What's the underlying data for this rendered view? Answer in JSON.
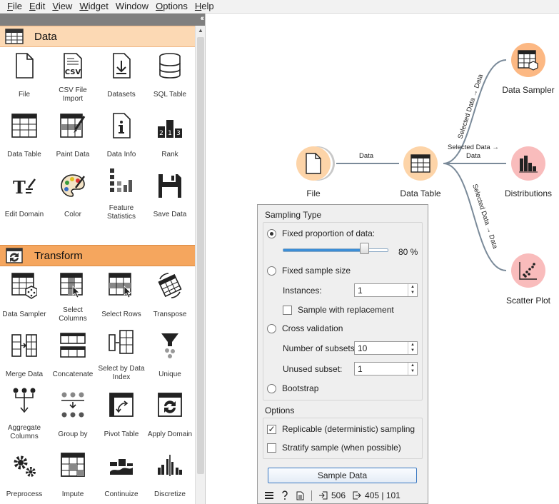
{
  "menu": {
    "items": [
      {
        "label": "File",
        "mnemonic": "F",
        "rest": "ile"
      },
      {
        "label": "Edit",
        "mnemonic": "E",
        "rest": "dit"
      },
      {
        "label": "View",
        "mnemonic": "V",
        "rest": "iew"
      },
      {
        "label": "Widget",
        "mnemonic": "W",
        "rest": "idget"
      },
      {
        "label": "Window",
        "mnemonic": "",
        "rest": "Window"
      },
      {
        "label": "Options",
        "mnemonic": "O",
        "rest": "ptions"
      },
      {
        "label": "Help",
        "mnemonic": "H",
        "rest": "elp"
      }
    ]
  },
  "toolbox": {
    "data_category": {
      "title": "Data",
      "widgets": [
        {
          "label": "File",
          "icon": "file-icon"
        },
        {
          "label": "CSV File Import",
          "icon": "csv-file-icon"
        },
        {
          "label": "Datasets",
          "icon": "datasets-icon"
        },
        {
          "label": "SQL Table",
          "icon": "database-icon"
        },
        {
          "label": "Data Table",
          "icon": "table-icon"
        },
        {
          "label": "Paint Data",
          "icon": "paint-data-icon"
        },
        {
          "label": "Data Info",
          "icon": "info-icon"
        },
        {
          "label": "Rank",
          "icon": "rank-icon"
        },
        {
          "label": "Edit Domain",
          "icon": "edit-domain-icon"
        },
        {
          "label": "Color",
          "icon": "palette-icon"
        },
        {
          "label": "Feature Statistics",
          "icon": "feature-statistics-icon"
        },
        {
          "label": "Save Data",
          "icon": "floppy-disk-icon"
        }
      ]
    },
    "transform_category": {
      "title": "Transform",
      "widgets": [
        {
          "label": "Data Sampler",
          "icon": "data-sampler-icon"
        },
        {
          "label": "Select Columns",
          "icon": "select-columns-icon"
        },
        {
          "label": "Select Rows",
          "icon": "select-rows-icon"
        },
        {
          "label": "Transpose",
          "icon": "transpose-icon"
        },
        {
          "label": "Merge Data",
          "icon": "merge-data-icon"
        },
        {
          "label": "Concatenate",
          "icon": "concatenate-icon"
        },
        {
          "label": "Select by Data Index",
          "icon": "select-by-index-icon"
        },
        {
          "label": "Unique",
          "icon": "funnel-icon"
        },
        {
          "label": "Aggregate Columns",
          "icon": "aggregate-icon"
        },
        {
          "label": "Group by",
          "icon": "group-by-icon"
        },
        {
          "label": "Pivot Table",
          "icon": "pivot-icon"
        },
        {
          "label": "Apply Domain",
          "icon": "apply-domain-icon"
        },
        {
          "label": "Preprocess",
          "icon": "gears-icon"
        },
        {
          "label": "Impute",
          "icon": "impute-icon"
        },
        {
          "label": "Continuize",
          "icon": "continuize-icon"
        },
        {
          "label": "Discretize",
          "icon": "discretize-icon"
        }
      ]
    }
  },
  "canvas": {
    "nodes": [
      {
        "id": "file",
        "label": "File",
        "icon": "file-icon"
      },
      {
        "id": "data-table",
        "label": "Data Table",
        "icon": "table-icon"
      },
      {
        "id": "data-sampler",
        "label": "Data Sampler",
        "icon": "data-sampler-icon"
      },
      {
        "id": "distributions",
        "label": "Distributions",
        "icon": "bar-chart-icon"
      },
      {
        "id": "scatter-plot",
        "label": "Scatter Plot",
        "icon": "scatter-icon"
      }
    ],
    "links": [
      {
        "from": "file",
        "to": "data-table",
        "label": "Data"
      },
      {
        "from": "data-table",
        "to": "data-sampler",
        "label": "Selected Data → Data"
      },
      {
        "from": "data-table",
        "to": "distributions",
        "label_line1": "Selected Data →",
        "label_line2": "Data"
      },
      {
        "from": "data-table",
        "to": "scatter-plot",
        "label": "Selected Data → Data"
      }
    ]
  },
  "sampler": {
    "sampling_type_title": "Sampling Type",
    "fixed_proportion_label": "Fixed proportion of data:",
    "proportion_percent": 80,
    "proportion_display": "80 %",
    "fixed_sample_size_label": "Fixed sample size",
    "instances_label": "Instances:",
    "instances_value": "1",
    "sample_with_replacement_label": "Sample with replacement",
    "cross_validation_label": "Cross validation",
    "number_of_subsets_label": "Number of subsets:",
    "number_of_subsets_value": "10",
    "unused_subset_label": "Unused subset:",
    "unused_subset_value": "1",
    "bootstrap_label": "Bootstrap",
    "options_title": "Options",
    "replicable_label": "Replicable (deterministic) sampling",
    "replicable_checked": true,
    "stratify_label": "Stratify sample (when possible)",
    "stratify_checked": false,
    "sample_button_label": "Sample Data",
    "status": {
      "input_count": "506",
      "output_count": "405 | 101"
    }
  },
  "colors": {
    "data_category": "#fcd9b4",
    "transform_category": "#f5a65e",
    "node_orange": "#fdd4a8",
    "node_red": "#f9bcbc",
    "accent_blue": "#3c8ed6"
  }
}
